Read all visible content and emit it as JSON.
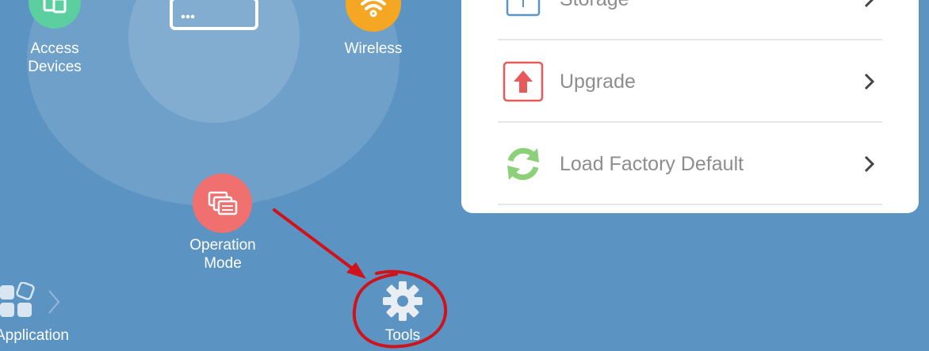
{
  "nodes": {
    "access_devices": {
      "label": "Access\nDevices",
      "color": "#5ccfa0"
    },
    "router": {
      "color": "#ffffff"
    },
    "wireless": {
      "label": "Wireless",
      "color": "#f5a623"
    },
    "operation_mode": {
      "label": "Operation\nMode",
      "color": "#f07070"
    },
    "application": {
      "label": "Application"
    },
    "tools": {
      "label": "Tools"
    }
  },
  "menu": {
    "items": [
      {
        "label": "Storage",
        "icon": "usb-icon",
        "color": "#5b93c2"
      },
      {
        "label": "Upgrade",
        "icon": "upgrade-arrow-icon",
        "color": "#e85a5a"
      },
      {
        "label": "Load Factory Default",
        "icon": "refresh-icon",
        "color": "#8cd17a"
      }
    ]
  },
  "colors": {
    "background": "#5b93c2",
    "annotation": "#d0121b",
    "menu_text": "#8d8d8d"
  }
}
